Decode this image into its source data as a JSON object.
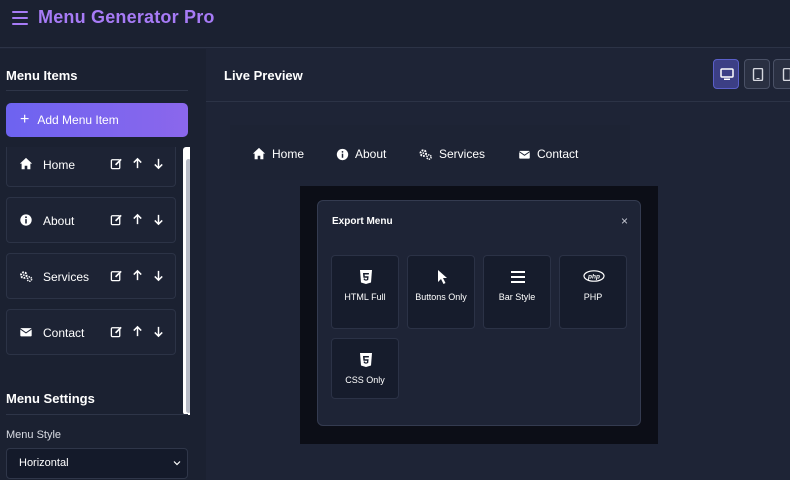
{
  "app": {
    "title": "Menu Generator Pro"
  },
  "sidebar": {
    "menu_items_title": "Menu Items",
    "add_button_label": "Add Menu Item",
    "items": [
      {
        "label": "Home",
        "icon": "home-icon"
      },
      {
        "label": "About",
        "icon": "info-icon"
      },
      {
        "label": "Services",
        "icon": "cogs-icon"
      },
      {
        "label": "Contact",
        "icon": "envelope-icon"
      }
    ],
    "settings_title": "Menu Settings",
    "menu_style_label": "Menu Style",
    "menu_style_value": "Horizontal"
  },
  "main": {
    "preview_title": "Live Preview",
    "devices": [
      "desktop-icon",
      "tablet-icon",
      "mobile-icon"
    ],
    "preview_links": [
      {
        "label": "Home",
        "icon": "home-icon"
      },
      {
        "label": "About",
        "icon": "info-icon"
      },
      {
        "label": "Services",
        "icon": "cogs-icon"
      },
      {
        "label": "Contact",
        "icon": "envelope-icon"
      }
    ]
  },
  "modal": {
    "title": "Export Menu",
    "close": "×",
    "options": [
      {
        "label": "HTML Full",
        "icon": "html5-icon"
      },
      {
        "label": "Buttons Only",
        "icon": "cursor-icon"
      },
      {
        "label": "Bar Style",
        "icon": "bars-icon"
      },
      {
        "label": "PHP",
        "icon": "php-icon"
      },
      {
        "label": "CSS Only",
        "icon": "css3-icon"
      }
    ]
  },
  "colors": {
    "accent": "#a77bf6",
    "button_gradient_start": "#6d63f0",
    "button_gradient_end": "#8b67ec",
    "background": "#1e2436"
  }
}
